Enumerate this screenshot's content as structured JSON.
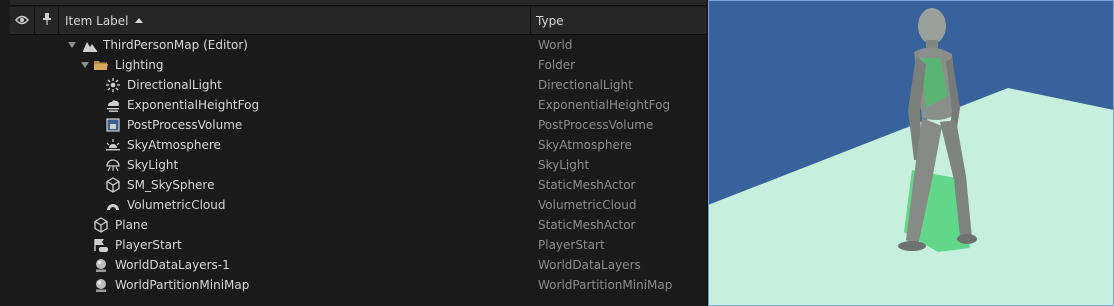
{
  "header": {
    "item_label": "Item Label",
    "type_label": "Type"
  },
  "rows": [
    {
      "label": "ThirdPersonMap (Editor)",
      "type": "World",
      "icon": "world-map-icon",
      "depth": 0,
      "expanded": true
    },
    {
      "label": "Lighting",
      "type": "Folder",
      "icon": "folder-icon",
      "depth": 1,
      "expanded": true
    },
    {
      "label": "DirectionalLight",
      "type": "DirectionalLight",
      "icon": "directional-light-icon",
      "depth": 2
    },
    {
      "label": "ExponentialHeightFog",
      "type": "ExponentialHeightFog",
      "icon": "height-fog-icon",
      "depth": 2
    },
    {
      "label": "PostProcessVolume",
      "type": "PostProcessVolume",
      "icon": "post-process-volume-icon",
      "depth": 2
    },
    {
      "label": "SkyAtmosphere",
      "type": "SkyAtmosphere",
      "icon": "sky-atmosphere-icon",
      "depth": 2
    },
    {
      "label": "SkyLight",
      "type": "SkyLight",
      "icon": "sky-light-icon",
      "depth": 2
    },
    {
      "label": "SM_SkySphere",
      "type": "StaticMeshActor",
      "icon": "static-mesh-icon",
      "depth": 2
    },
    {
      "label": "VolumetricCloud",
      "type": "VolumetricCloud",
      "icon": "volumetric-cloud-icon",
      "depth": 2
    },
    {
      "label": "Plane",
      "type": "StaticMeshActor",
      "icon": "static-mesh-icon",
      "depth": 1
    },
    {
      "label": "PlayerStart",
      "type": "PlayerStart",
      "icon": "player-start-icon",
      "depth": 1
    },
    {
      "label": "WorldDataLayers-1",
      "type": "WorldDataLayers",
      "icon": "world-data-layers-icon",
      "depth": 1
    },
    {
      "label": "WorldPartitionMiniMap",
      "type": "WorldPartitionMiniMap",
      "icon": "world-partition-minimap-icon",
      "depth": 1
    }
  ],
  "colors": {
    "viewport_sky": "#38629b",
    "ground": "#c6f0dd",
    "ground_shadow": "#3fcf6e",
    "mannequin": "#8a8f8c"
  }
}
